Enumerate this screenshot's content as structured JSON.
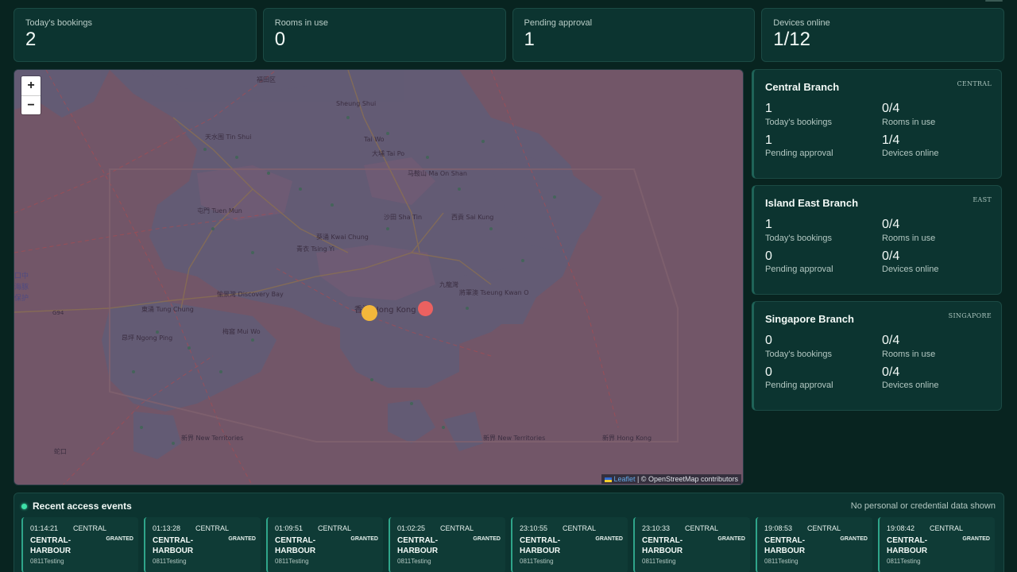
{
  "stats": [
    {
      "label": "Today's bookings",
      "value": "2"
    },
    {
      "label": "Rooms in use",
      "value": "0"
    },
    {
      "label": "Pending approval",
      "value": "1"
    },
    {
      "label": "Devices online",
      "value": "1/12"
    }
  ],
  "map": {
    "zoom_in": "+",
    "zoom_out": "−",
    "attribution_link": "Leaflet",
    "attribution_text": " | © OpenStreetMap contributors",
    "labels": {
      "shenzhen": "福田区",
      "sheung_shui": "Sheung Shui",
      "tai_wo": "Tai Wo",
      "tin_shui_wai": "天水围 Tin Shui",
      "tai_po": "大埔 Tai Po",
      "ma_on_shan": "马鞍山 Ma On Shan",
      "tuen_mun": "屯門 Tuen Mun",
      "sha_tin": "沙田 Sha Tin",
      "sai_kung": "西貢 Sai Kung",
      "kwai_chung": "葵涌 Kwai Chung",
      "tsing_yi": "青衣 Tsing Yi",
      "discovery_bay": "愉景灣 Discovery Bay",
      "tung_chung": "東涌 Tung Chung",
      "mui_wo": "梅窩 Mui Wo",
      "hong_kong": "香港 Hong Kong",
      "kowloon_bay": "九龍灣",
      "tseung_kwan_o": "將軍澳 Tseung Kwan O",
      "ngong_ping": "昂坪 Ngong Ping",
      "new_territories_1": "新界 New Territories",
      "new_territories_2": "新界 New Territories",
      "new_territories_3": "新界 Hong Kong",
      "macau_1": "口中",
      "macau_2": "海豚",
      "macau_3": "保护",
      "road_g94": "G94",
      "shekou": "蛇口"
    }
  },
  "branches": [
    {
      "name": "Central Branch",
      "code": "CENTRAL",
      "bookings": "1",
      "bookings_label": "Today's bookings",
      "rooms": "0/4",
      "rooms_label": "Rooms in use",
      "pending": "1",
      "pending_label": "Pending approval",
      "devices": "1/4",
      "devices_label": "Devices online"
    },
    {
      "name": "Island East Branch",
      "code": "EAST",
      "bookings": "1",
      "bookings_label": "Today's bookings",
      "rooms": "0/4",
      "rooms_label": "Rooms in use",
      "pending": "0",
      "pending_label": "Pending approval",
      "devices": "0/4",
      "devices_label": "Devices online"
    },
    {
      "name": "Singapore Branch",
      "code": "SINGAPORE",
      "bookings": "0",
      "bookings_label": "Today's bookings",
      "rooms": "0/4",
      "rooms_label": "Rooms in use",
      "pending": "0",
      "pending_label": "Pending approval",
      "devices": "0/4",
      "devices_label": "Devices online"
    }
  ],
  "events": {
    "title": "Recent access events",
    "note": "No personal or credential data shown",
    "items": [
      {
        "time": "01:14:21",
        "branch": "CENTRAL",
        "room": "CENTRAL-HARBOUR",
        "status": "GRANTED",
        "user": "0811Testing"
      },
      {
        "time": "01:13:28",
        "branch": "CENTRAL",
        "room": "CENTRAL-HARBOUR",
        "status": "GRANTED",
        "user": "0811Testing"
      },
      {
        "time": "01:09:51",
        "branch": "CENTRAL",
        "room": "CENTRAL-HARBOUR",
        "status": "GRANTED",
        "user": "0811Testing"
      },
      {
        "time": "01:02:25",
        "branch": "CENTRAL",
        "room": "CENTRAL-HARBOUR",
        "status": "GRANTED",
        "user": "0811Testing"
      },
      {
        "time": "23:10:55",
        "branch": "CENTRAL",
        "room": "CENTRAL-HARBOUR",
        "status": "GRANTED",
        "user": "0811Testing"
      },
      {
        "time": "23:10:33",
        "branch": "CENTRAL",
        "room": "CENTRAL-HARBOUR",
        "status": "GRANTED",
        "user": "0811Testing"
      },
      {
        "time": "19:08:53",
        "branch": "CENTRAL",
        "room": "CENTRAL-HARBOUR",
        "status": "GRANTED",
        "user": "0811Testing"
      },
      {
        "time": "19:08:42",
        "branch": "CENTRAL",
        "room": "CENTRAL-HARBOUR",
        "status": "GRANTED",
        "user": "0811Testing"
      }
    ]
  },
  "colors": {
    "background": "#082420",
    "card": "#0c3430",
    "accent": "#3ee0a8",
    "marker_yellow": "#f3b73b",
    "marker_red": "#eb6160"
  }
}
